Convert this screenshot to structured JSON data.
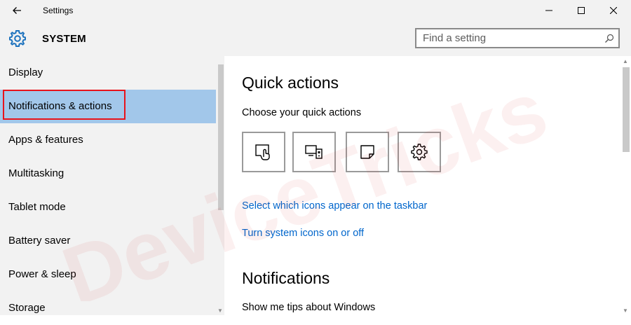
{
  "window": {
    "title": "Settings"
  },
  "header": {
    "section_title": "SYSTEM",
    "search_placeholder": "Find a setting"
  },
  "sidebar": {
    "items": [
      {
        "label": "Display"
      },
      {
        "label": "Notifications & actions",
        "selected": true
      },
      {
        "label": "Apps & features"
      },
      {
        "label": "Multitasking"
      },
      {
        "label": "Tablet mode"
      },
      {
        "label": "Battery saver"
      },
      {
        "label": "Power & sleep"
      },
      {
        "label": "Storage"
      }
    ]
  },
  "main": {
    "quick_actions_heading": "Quick actions",
    "choose_label": "Choose your quick actions",
    "tiles": [
      {
        "icon": "tablet-mode-icon"
      },
      {
        "icon": "connect-icon"
      },
      {
        "icon": "note-icon"
      },
      {
        "icon": "all-settings-icon"
      }
    ],
    "link_taskbar": "Select which icons appear on the taskbar",
    "link_system_icons": "Turn system icons on or off",
    "notifications_heading": "Notifications",
    "tips_label": "Show me tips about Windows"
  },
  "watermark": {
    "text": "DeviceTricks"
  },
  "colors": {
    "chrome_bg": "#f2f2f2",
    "selected_bg": "#a2c7ea",
    "highlight_border": "#e8131b",
    "link": "#0066cc",
    "accent": "#1e73be"
  }
}
